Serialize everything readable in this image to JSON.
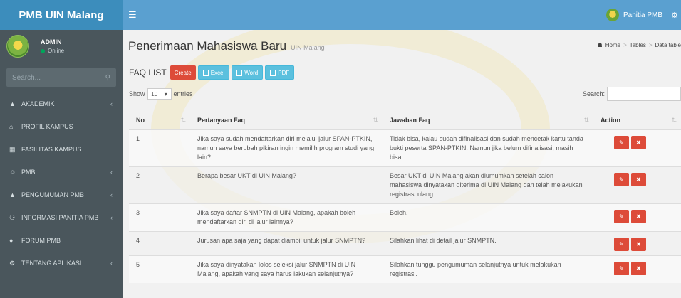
{
  "app": {
    "brand": "PMB UIN Malang"
  },
  "topbar": {
    "menu_icon": "bars-icon",
    "user_name": "Panitia PMB",
    "settings_icon": "gear-icon"
  },
  "user_panel": {
    "name": "ADMIN",
    "status": "Online"
  },
  "sidebar": {
    "search_placeholder": "Search...",
    "items": [
      {
        "label": "AKADEMIK",
        "icon": "bank-icon",
        "chevron": true
      },
      {
        "label": "PROFIL KAMPUS",
        "icon": "home-icon",
        "chevron": false
      },
      {
        "label": "FASILITAS KAMPUS",
        "icon": "building-icon",
        "chevron": false
      },
      {
        "label": "PMB",
        "icon": "users-icon",
        "chevron": true
      },
      {
        "label": "PENGUMUMAN PMB",
        "icon": "bank-icon",
        "chevron": true
      },
      {
        "label": "INFORMASI PANITIA PMB",
        "icon": "group-icon",
        "chevron": true
      },
      {
        "label": "FORUM PMB",
        "icon": "comments-icon",
        "chevron": false
      },
      {
        "label": "TENTANG APLIKASI",
        "icon": "gear-icon",
        "chevron": true
      }
    ]
  },
  "page": {
    "title": "Penerimaan Mahasiswa Baru",
    "subtitle": "UIN Malang",
    "breadcrumb": [
      "Home",
      "Tables",
      "Data tables"
    ]
  },
  "box": {
    "title": "FAQ LIST",
    "buttons": {
      "create": "Create",
      "excel": "Excel",
      "word": "Word",
      "pdf": "PDF"
    }
  },
  "controls": {
    "show_label": "Show",
    "page_size": "10",
    "entries_label": "entries",
    "search_label": "Search:"
  },
  "table": {
    "headers": {
      "no": "No",
      "question": "Pertanyaan Faq",
      "answer": "Jawaban Faq",
      "action": "Action"
    },
    "rows": [
      {
        "no": "1",
        "question": "Jika saya sudah mendaftarkan diri melalui jalur SPAN-PTKIN, namun saya berubah pikiran ingin memilih program studi yang lain?",
        "answer": "Tidak bisa, kalau sudah difinalisasi dan sudah mencetak kartu tanda bukti peserta SPAN-PTKIN. Namun jika belum difinalisasi, masih bisa."
      },
      {
        "no": "2",
        "question": "Berapa besar UKT di UIN Malang?",
        "answer": "Besar UKT di UIN Malang akan diumumkan setelah calon mahasiswa dinyatakan diterima di UIN Malang dan telah melakukan registrasi ulang."
      },
      {
        "no": "3",
        "question": "Jika saya daftar SNMPTN di UIN Malang, apakah boleh mendaftarkan diri di jalur lainnya?",
        "answer": "Boleh."
      },
      {
        "no": "4",
        "question": "Jurusan apa saja yang dapat diambil untuk jalur SNMPTN?",
        "answer": "Silahkan lihat di detail jalur SNMPTN."
      },
      {
        "no": "5",
        "question": "Jika saya dinyatakan lolos seleksi jalur SNMPTN di UIN Malang, apakah yang saya harus lakukan selanjutnya?",
        "answer": "Silahkan tunggu pengumuman selanjutnya untuk melakukan registrasi."
      }
    ]
  },
  "colors": {
    "brand_blue": "#3c8dbc",
    "sidebar": "#4a565c",
    "danger": "#dd4b39",
    "info": "#5bc0de"
  }
}
